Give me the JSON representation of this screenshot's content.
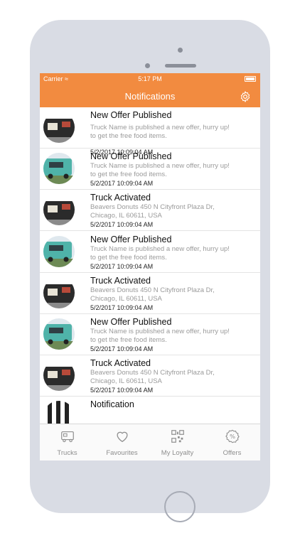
{
  "status_bar": {
    "carrier": "Carrier",
    "time": "5:17 PM"
  },
  "nav": {
    "title": "Notifications",
    "settings_icon": "gear-icon"
  },
  "notifications": [
    {
      "title": "New Offer Published",
      "description": "Truck Name is published a new offer, hurry up! to get the free food items.",
      "date": "5/2/2017 10:09:04 AM",
      "image": "dark-truck-photo"
    },
    {
      "title": "New Offer Published",
      "description": "Truck Name is published a new offer, hurry up! to get the free food items.",
      "date": "5/2/2017 10:09:04 AM",
      "image": "teal-truck-photo"
    },
    {
      "title": "Truck Activated",
      "description": "Beavers Donuts 450 N Cityfront Plaza Dr, Chicago, IL 60611, USA",
      "date": "5/2/2017 10:09:04 AM",
      "image": "dark-truck-photo"
    },
    {
      "title": "New Offer Published",
      "description": "Truck Name is published a new offer, hurry up! to get the free food items.",
      "date": "5/2/2017 10:09:04 AM",
      "image": "teal-truck-photo"
    },
    {
      "title": "Truck Activated",
      "description": "Beavers Donuts 450 N Cityfront Plaza Dr, Chicago, IL 60611, USA",
      "date": "5/2/2017 10:09:04 AM",
      "image": "dark-truck-photo"
    },
    {
      "title": "New Offer Published",
      "description": "Truck Name is published a new offer, hurry up! to get the free food items.",
      "date": "5/2/2017 10:09:04 AM",
      "image": "teal-truck-photo"
    },
    {
      "title": "Truck Activated",
      "description": "Beavers Donuts 450 N Cityfront Plaza Dr, Chicago, IL 60611, USA",
      "date": "5/2/2017 10:09:04 AM",
      "image": "dark-truck-photo"
    },
    {
      "title": "Notification",
      "description": "",
      "date": "",
      "image": "striped-photo"
    }
  ],
  "tabs": [
    {
      "label": "Trucks",
      "icon": "truck-icon"
    },
    {
      "label": "Favourites",
      "icon": "heart-icon"
    },
    {
      "label": "My Loyalty",
      "icon": "qr-code-icon"
    },
    {
      "label": "Offers",
      "icon": "percent-badge-icon"
    }
  ],
  "colors": {
    "accent": "#f28b40",
    "tab_icon": "#8e8e8e",
    "teal_truck": "#4fb3a9"
  }
}
